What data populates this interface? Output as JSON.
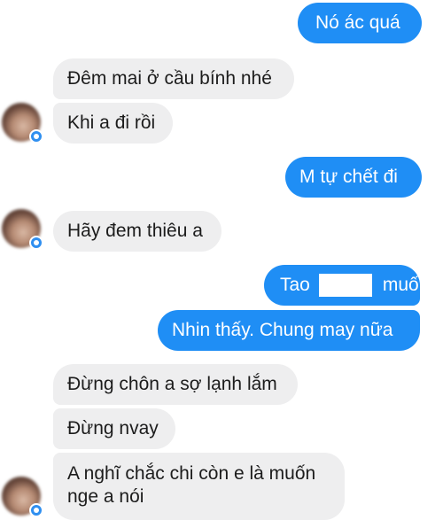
{
  "colors": {
    "outgoing_bubble": "#1f8ef5",
    "incoming_bubble": "#eeeeef",
    "outgoing_text": "#ffffff",
    "incoming_text": "#1c1c1c"
  },
  "messages": [
    {
      "direction": "outgoing",
      "text": "Nó ác quá"
    },
    {
      "direction": "incoming",
      "text": "Đêm mai ở cầu bính nhé"
    },
    {
      "direction": "incoming",
      "text": "Khi a đi rồi"
    },
    {
      "direction": "outgoing",
      "text": "M tự chết đi"
    },
    {
      "direction": "incoming",
      "text": "Hãy đem thiêu a"
    },
    {
      "direction": "outgoing",
      "text_before": "Tao",
      "text_after": "muốn"
    },
    {
      "direction": "outgoing",
      "text": "Nhin thấy. Chung may nữa"
    },
    {
      "direction": "incoming",
      "text": "Đừng chôn a sợ lạnh lắm"
    },
    {
      "direction": "incoming",
      "text": "Đừng nvay"
    },
    {
      "direction": "incoming",
      "text_line1": "A nghĩ chắc chi còn e là muốn",
      "text_line2": "nge a nói"
    }
  ],
  "avatar": {
    "icon": "blurred-contact-avatar",
    "badge_icon": "messenger-badge-icon"
  }
}
